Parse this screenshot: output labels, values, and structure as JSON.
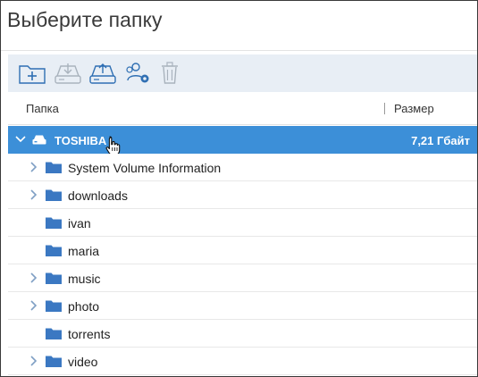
{
  "dialog": {
    "title": "Выберите папку"
  },
  "toolbar": {
    "buttons": [
      {
        "icon": "new-folder-icon",
        "enabled": true
      },
      {
        "icon": "download-drive-icon",
        "enabled": false
      },
      {
        "icon": "upload-drive-icon",
        "enabled": true
      },
      {
        "icon": "user-settings-icon",
        "enabled": true
      },
      {
        "icon": "trash-icon",
        "enabled": false
      }
    ]
  },
  "columns": {
    "name": "Папка",
    "size": "Размер"
  },
  "tree": {
    "root": {
      "label": "TOSHIBA",
      "size": "7,21 Гбайт",
      "icon": "drive-icon",
      "expanded": true,
      "selected": true
    },
    "items": [
      {
        "label": "System Volume Information",
        "has_children": true
      },
      {
        "label": "downloads",
        "has_children": true
      },
      {
        "label": "ivan",
        "has_children": false
      },
      {
        "label": "maria",
        "has_children": false
      },
      {
        "label": "music",
        "has_children": true
      },
      {
        "label": "photo",
        "has_children": true
      },
      {
        "label": "torrents",
        "has_children": false
      },
      {
        "label": "video",
        "has_children": true
      }
    ]
  },
  "colors": {
    "accent": "#3c8fd8",
    "folder": "#3b78c2",
    "toolbar_bg": "#e8eef5",
    "icon_enabled": "#2f6fb3",
    "icon_disabled": "#a9b3bd"
  }
}
